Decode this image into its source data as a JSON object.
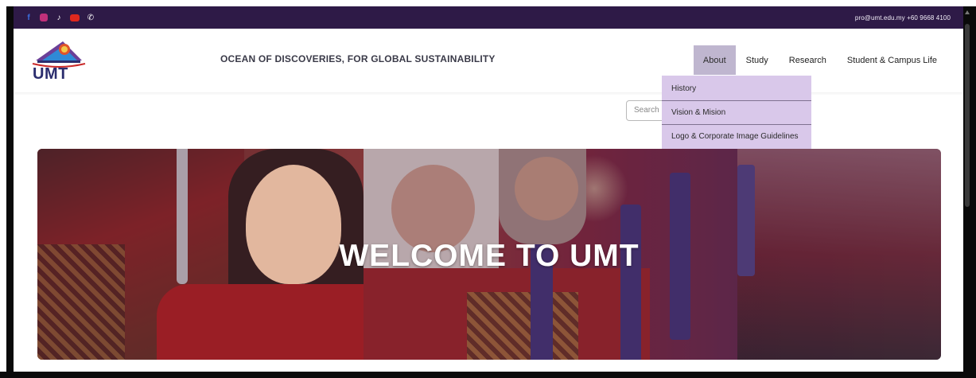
{
  "topbar": {
    "social_icons": [
      "facebook-icon",
      "instagram-icon",
      "tiktok-icon",
      "youtube-icon",
      "phone-icon"
    ],
    "contact_text": "pro@umt.edu.my +60 9668 4100",
    "background_color": "#2e1a47"
  },
  "header": {
    "logo_text": "UMT",
    "tagline": "OCEAN OF DISCOVERIES, FOR GLOBAL SUSTAINABILITY",
    "nav": [
      {
        "label": "About"
      },
      {
        "label": "Study"
      },
      {
        "label": "Research"
      },
      {
        "label": "Student & Campus Life"
      }
    ],
    "active_nav_color": "#bfb6cf"
  },
  "dropdown": {
    "items": [
      {
        "label": "History"
      },
      {
        "label": "Vision & Mision"
      },
      {
        "label": "Logo & Corporate Image Guidelines"
      }
    ],
    "background_color": "#d9c8ea"
  },
  "search": {
    "placeholder": "Search"
  },
  "hero": {
    "title": "WELCOME TO UMT"
  }
}
